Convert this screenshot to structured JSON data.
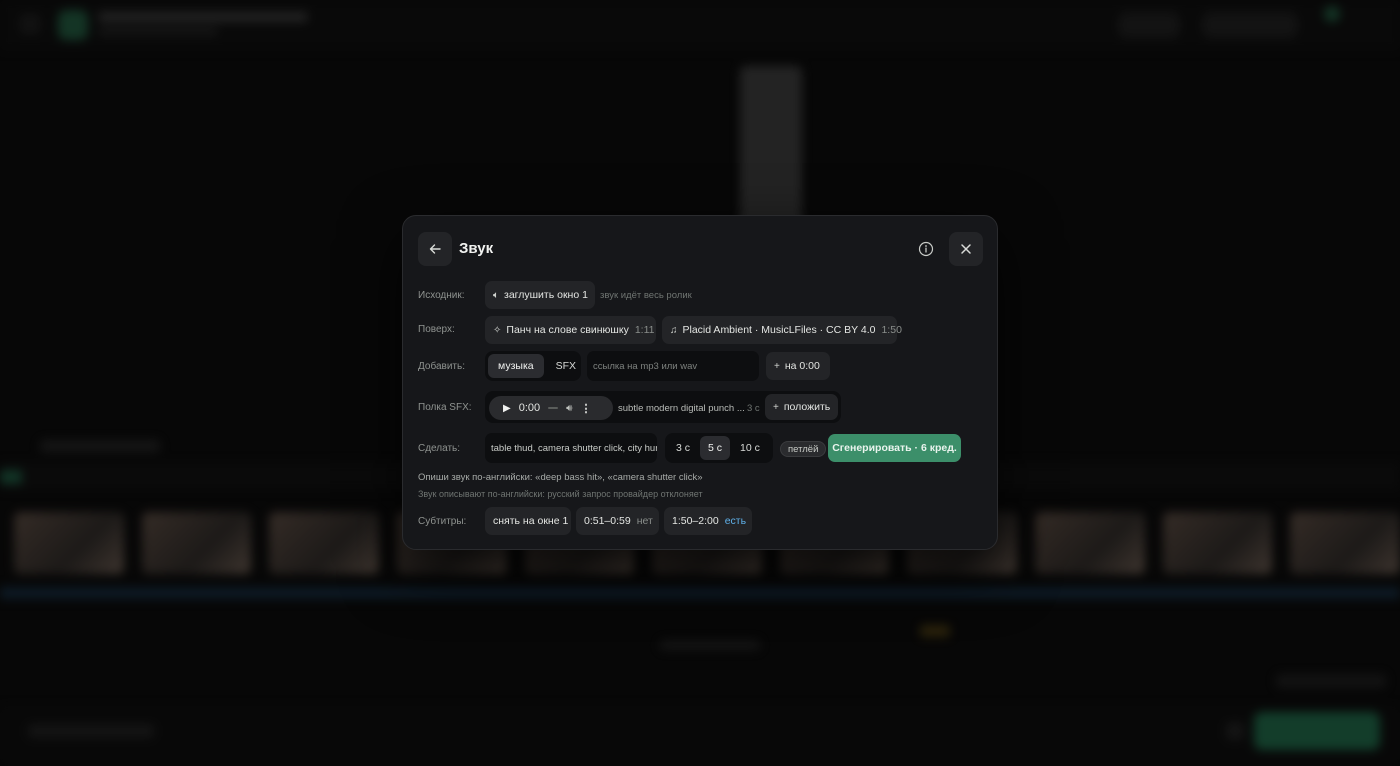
{
  "dialog": {
    "title": "Звук",
    "rows": {
      "source": {
        "label": "Исходник:",
        "mute_button": "заглушить окно 1",
        "hint": "звук идёт весь ролик"
      },
      "overlay": {
        "label": "Поверх:",
        "items": [
          {
            "icon": "sparkle-icon",
            "title": "Панч на слове свинюшку",
            "duration": "1:11"
          },
          {
            "icon": "music-note-icon",
            "title": "Placid Ambient · MusicLFiles · CC BY 4.0",
            "duration": "1:50"
          }
        ]
      },
      "add": {
        "label": "Добавить:",
        "tabs": [
          "музыка",
          "SFX"
        ],
        "active_tab": "музыка",
        "url_placeholder": "ссылка на mp3 или wav",
        "add_at_button": "на 0:00"
      },
      "sfx_shelf": {
        "label": "Полка SFX:",
        "player_time": "0:00",
        "item_title": "subtle modern digital punch ...",
        "item_duration": "3 с",
        "place_button": "положить"
      },
      "make": {
        "label": "Сделать:",
        "prompt_value": "table thud, camera shutter click, city hum",
        "durations": [
          "3 с",
          "5 с",
          "10 с"
        ],
        "active_duration": "5 с",
        "loop_label": "петлёй",
        "generate_button": "Сгенерировать · 6 кред."
      },
      "notes": [
        "Опиши звук по-английски: «deep bass hit», «camera shutter click»",
        "Звук описывают по-английски: русский запрос провайдер отклоняет"
      ],
      "subtitles": {
        "label": "Субтитры:",
        "remove_button": "снять на окне 1",
        "ranges": [
          {
            "range": "0:51–0:59",
            "status": "нет"
          },
          {
            "range": "1:50–2:00",
            "status": "есть"
          }
        ]
      }
    }
  },
  "colors": {
    "accent_green": "#3c8f6a",
    "link_blue": "#5fb0e8",
    "panel_bg": "#16171a"
  }
}
